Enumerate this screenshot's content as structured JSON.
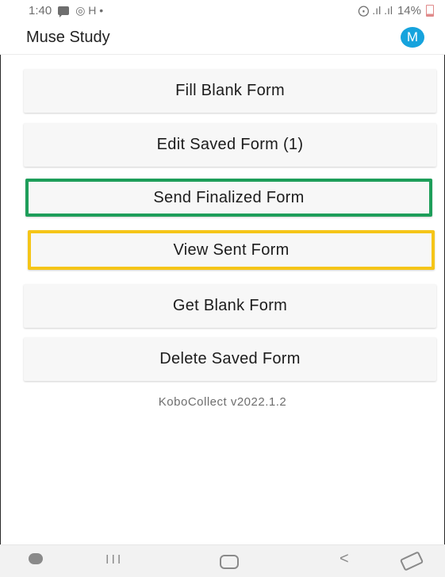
{
  "status_bar": {
    "time": "1:40",
    "left_glyphs": "◎ H •",
    "battery_percent": "14%",
    "signal_glyph": "⨀ .ıl .ıl"
  },
  "app_bar": {
    "title": "Muse Study",
    "avatar_initial": "M"
  },
  "menu": {
    "fill_blank": "Fill Blank Form",
    "edit_saved": "Edit Saved Form (1)",
    "send_finalized": "Send Finalized Form",
    "view_sent": "View Sent Form",
    "get_blank": "Get Blank Form",
    "delete_saved": "Delete Saved Form"
  },
  "version": "KoboCollect v2022.1.2",
  "highlights": {
    "send_finalized_border": "#1e9e5a",
    "view_sent_border": "#f5c518"
  },
  "nav_bar": {
    "recents_glyph": "III",
    "back_glyph": "<"
  }
}
